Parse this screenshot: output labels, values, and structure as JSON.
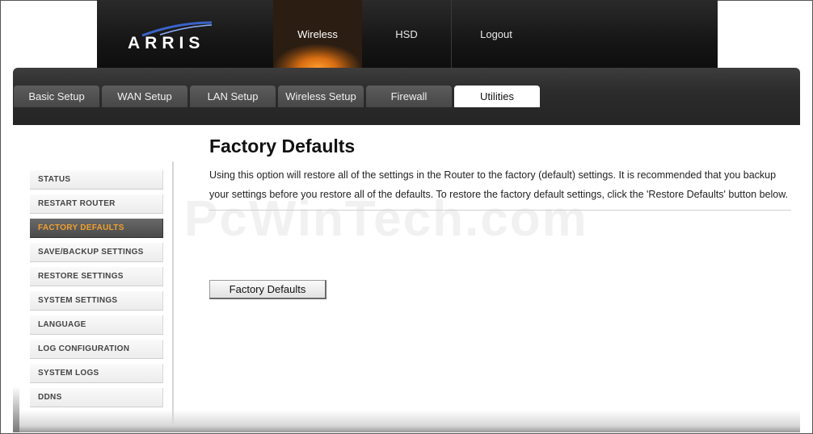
{
  "brand": {
    "logo_text": "ARRIS"
  },
  "top_nav": [
    "Wireless",
    "HSD",
    "Logout"
  ],
  "tabs": [
    "Basic Setup",
    "WAN Setup",
    "LAN Setup",
    "Wireless Setup",
    "Firewall",
    "Utilities"
  ],
  "sidebar": [
    "STATUS",
    "RESTART ROUTER",
    "FACTORY DEFAULTS",
    "SAVE/BACKUP SETTINGS",
    "RESTORE SETTINGS",
    "SYSTEM SETTINGS",
    "LANGUAGE",
    "LOG CONFIGURATION",
    "SYSTEM LOGS",
    "DDNS"
  ],
  "main": {
    "title": "Factory Defaults",
    "description": "Using this option will restore all of the settings in the Router to the factory (default) settings. It is recommended that you backup your settings before you restore all of the defaults. To restore the factory default settings, click the 'Restore Defaults' button below.",
    "button_label": "Factory Defaults"
  },
  "watermark": "PcWinTech.com",
  "colors": {
    "accent_orange": "#f0a030",
    "header_dark": "#161616"
  },
  "state": {
    "active_top_nav": "Wireless",
    "active_tab": "Utilities",
    "active_sidebar": "FACTORY DEFAULTS"
  }
}
